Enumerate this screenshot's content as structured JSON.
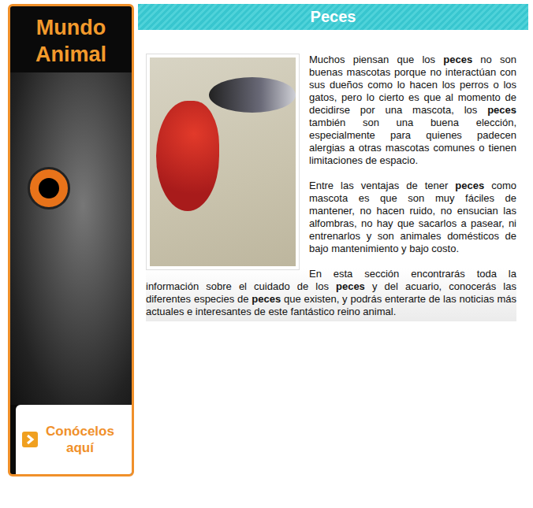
{
  "sidebar": {
    "title_lines": [
      "Mundo",
      "Animal"
    ],
    "button_lines": [
      "Conócelos",
      "aquí"
    ]
  },
  "header": {
    "title": "Peces"
  },
  "paragraphs": [
    [
      {
        "text": "Muchos piensan que los ",
        "bold": false
      },
      {
        "text": "peces",
        "bold": true
      },
      {
        "text": " no son buenas mascotas porque no interactúan con sus dueños como lo hacen los perros o los gatos, pero lo cierto es que al momento de decidirse por una mascota, los ",
        "bold": false
      },
      {
        "text": "peces",
        "bold": true
      },
      {
        "text": " también son una buena elección, especialmente para quienes padecen alergias a otras mascotas comunes o tienen limitaciones de espacio.",
        "bold": false
      }
    ],
    [
      {
        "text": "Entre las ventajas de tener ",
        "bold": false
      },
      {
        "text": "peces",
        "bold": true
      },
      {
        "text": " como mascota es que son muy fáciles de mantener, no hacen ruido, no ensucian las alfombras, no hay que sacarlos a pasear, ni entrenarlos y son animales domésticos de bajo mantenimiento y bajo costo.",
        "bold": false
      }
    ],
    [
      {
        "text": "En esta sección encontrarás toda la información sobre el cuidado de los ",
        "bold": false
      },
      {
        "text": "peces",
        "bold": true
      },
      {
        "text": " y del acuario, conocerás las diferentes especies de ",
        "bold": false
      },
      {
        "text": "peces",
        "bold": true
      },
      {
        "text": " que existen, y podrás enterarte de las noticias más actuales e interesantes de este fantástico reino animal.",
        "bold": false
      }
    ]
  ]
}
